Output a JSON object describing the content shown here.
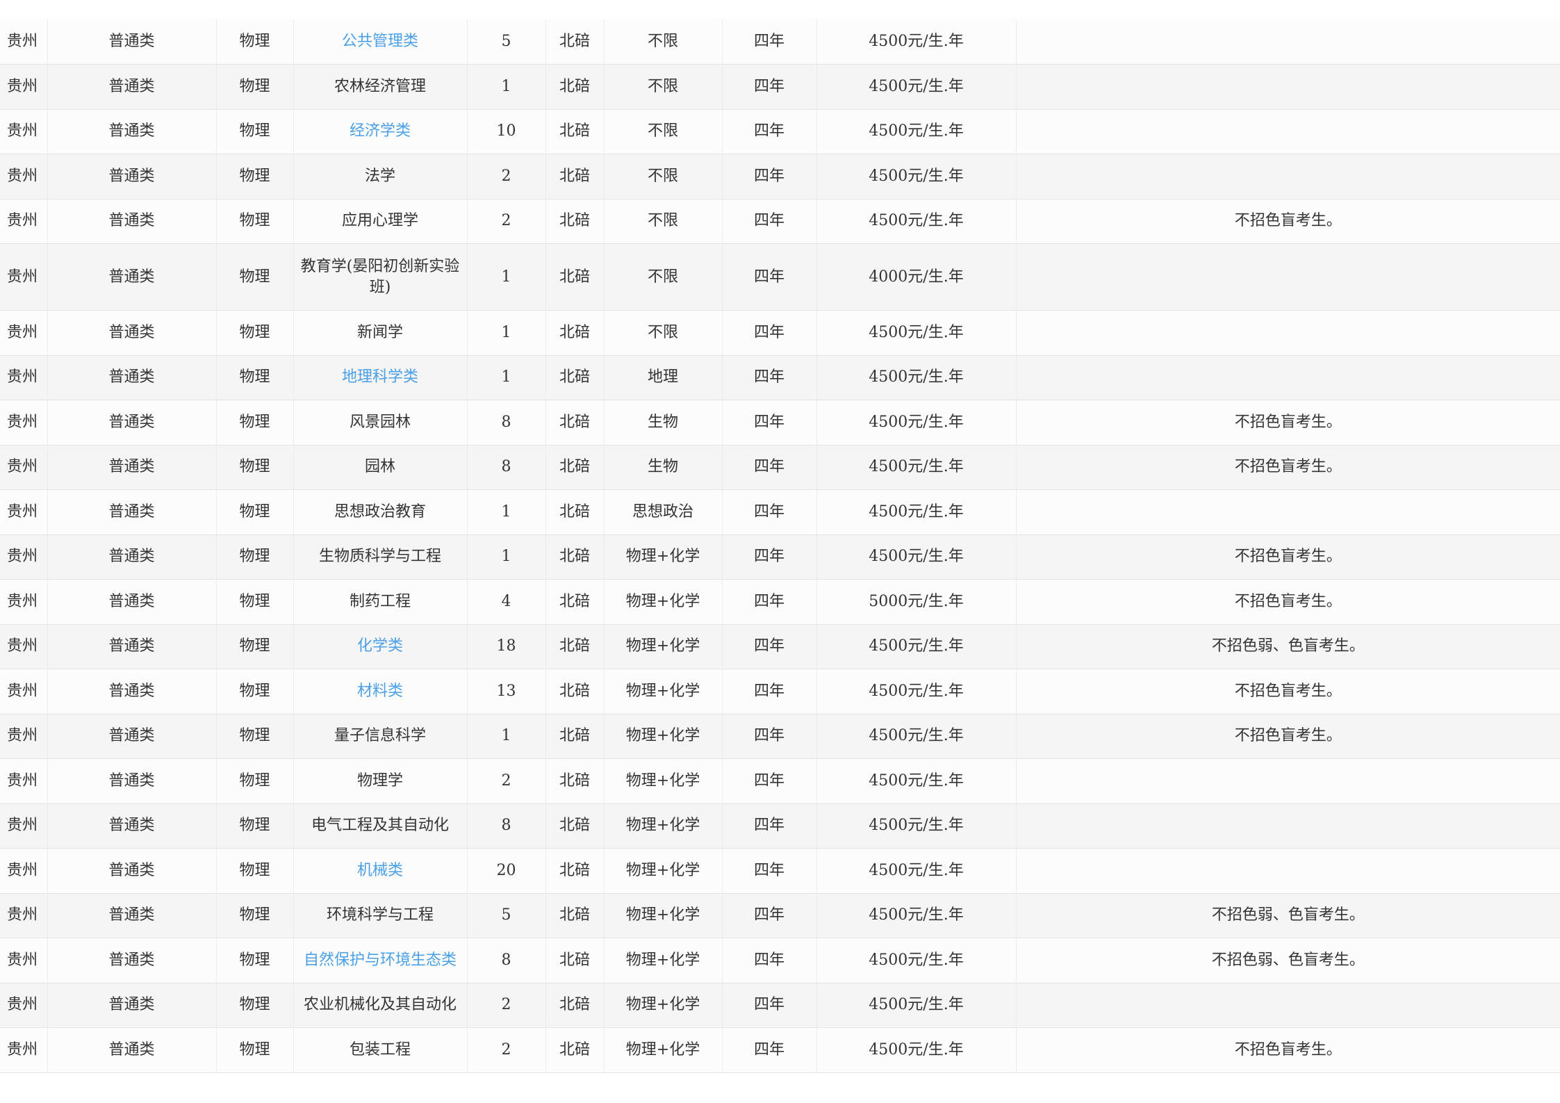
{
  "rows": [
    {
      "province": "贵州",
      "type": "普通类",
      "subject": "物理",
      "major": "公共管理类",
      "is_link": true,
      "count": "5",
      "campus": "北碚",
      "requirement": "不限",
      "duration": "四年",
      "fee": "4500元/生.年",
      "note": ""
    },
    {
      "province": "贵州",
      "type": "普通类",
      "subject": "物理",
      "major": "农林经济管理",
      "is_link": false,
      "count": "1",
      "campus": "北碚",
      "requirement": "不限",
      "duration": "四年",
      "fee": "4500元/生.年",
      "note": ""
    },
    {
      "province": "贵州",
      "type": "普通类",
      "subject": "物理",
      "major": "经济学类",
      "is_link": true,
      "count": "10",
      "campus": "北碚",
      "requirement": "不限",
      "duration": "四年",
      "fee": "4500元/生.年",
      "note": ""
    },
    {
      "province": "贵州",
      "type": "普通类",
      "subject": "物理",
      "major": "法学",
      "is_link": false,
      "count": "2",
      "campus": "北碚",
      "requirement": "不限",
      "duration": "四年",
      "fee": "4500元/生.年",
      "note": ""
    },
    {
      "province": "贵州",
      "type": "普通类",
      "subject": "物理",
      "major": "应用心理学",
      "is_link": false,
      "count": "2",
      "campus": "北碚",
      "requirement": "不限",
      "duration": "四年",
      "fee": "4500元/生.年",
      "note": "不招色盲考生。"
    },
    {
      "province": "贵州",
      "type": "普通类",
      "subject": "物理",
      "major": "教育学(晏阳初创新实验班)",
      "is_link": false,
      "count": "1",
      "campus": "北碚",
      "requirement": "不限",
      "duration": "四年",
      "fee": "4000元/生.年",
      "note": ""
    },
    {
      "province": "贵州",
      "type": "普通类",
      "subject": "物理",
      "major": "新闻学",
      "is_link": false,
      "count": "1",
      "campus": "北碚",
      "requirement": "不限",
      "duration": "四年",
      "fee": "4500元/生.年",
      "note": ""
    },
    {
      "province": "贵州",
      "type": "普通类",
      "subject": "物理",
      "major": "地理科学类",
      "is_link": true,
      "count": "1",
      "campus": "北碚",
      "requirement": "地理",
      "duration": "四年",
      "fee": "4500元/生.年",
      "note": ""
    },
    {
      "province": "贵州",
      "type": "普通类",
      "subject": "物理",
      "major": "风景园林",
      "is_link": false,
      "count": "8",
      "campus": "北碚",
      "requirement": "生物",
      "duration": "四年",
      "fee": "4500元/生.年",
      "note": "不招色盲考生。"
    },
    {
      "province": "贵州",
      "type": "普通类",
      "subject": "物理",
      "major": "园林",
      "is_link": false,
      "count": "8",
      "campus": "北碚",
      "requirement": "生物",
      "duration": "四年",
      "fee": "4500元/生.年",
      "note": "不招色盲考生。"
    },
    {
      "province": "贵州",
      "type": "普通类",
      "subject": "物理",
      "major": "思想政治教育",
      "is_link": false,
      "count": "1",
      "campus": "北碚",
      "requirement": "思想政治",
      "duration": "四年",
      "fee": "4500元/生.年",
      "note": ""
    },
    {
      "province": "贵州",
      "type": "普通类",
      "subject": "物理",
      "major": "生物质科学与工程",
      "is_link": false,
      "count": "1",
      "campus": "北碚",
      "requirement": "物理+化学",
      "duration": "四年",
      "fee": "4500元/生.年",
      "note": "不招色盲考生。"
    },
    {
      "province": "贵州",
      "type": "普通类",
      "subject": "物理",
      "major": "制药工程",
      "is_link": false,
      "count": "4",
      "campus": "北碚",
      "requirement": "物理+化学",
      "duration": "四年",
      "fee": "5000元/生.年",
      "note": "不招色盲考生。"
    },
    {
      "province": "贵州",
      "type": "普通类",
      "subject": "物理",
      "major": "化学类",
      "is_link": true,
      "count": "18",
      "campus": "北碚",
      "requirement": "物理+化学",
      "duration": "四年",
      "fee": "4500元/生.年",
      "note": "不招色弱、色盲考生。"
    },
    {
      "province": "贵州",
      "type": "普通类",
      "subject": "物理",
      "major": "材料类",
      "is_link": true,
      "count": "13",
      "campus": "北碚",
      "requirement": "物理+化学",
      "duration": "四年",
      "fee": "4500元/生.年",
      "note": "不招色盲考生。"
    },
    {
      "province": "贵州",
      "type": "普通类",
      "subject": "物理",
      "major": "量子信息科学",
      "is_link": false,
      "count": "1",
      "campus": "北碚",
      "requirement": "物理+化学",
      "duration": "四年",
      "fee": "4500元/生.年",
      "note": "不招色盲考生。"
    },
    {
      "province": "贵州",
      "type": "普通类",
      "subject": "物理",
      "major": "物理学",
      "is_link": false,
      "count": "2",
      "campus": "北碚",
      "requirement": "物理+化学",
      "duration": "四年",
      "fee": "4500元/生.年",
      "note": ""
    },
    {
      "province": "贵州",
      "type": "普通类",
      "subject": "物理",
      "major": "电气工程及其自动化",
      "is_link": false,
      "count": "8",
      "campus": "北碚",
      "requirement": "物理+化学",
      "duration": "四年",
      "fee": "4500元/生.年",
      "note": ""
    },
    {
      "province": "贵州",
      "type": "普通类",
      "subject": "物理",
      "major": "机械类",
      "is_link": true,
      "count": "20",
      "campus": "北碚",
      "requirement": "物理+化学",
      "duration": "四年",
      "fee": "4500元/生.年",
      "note": ""
    },
    {
      "province": "贵州",
      "type": "普通类",
      "subject": "物理",
      "major": "环境科学与工程",
      "is_link": false,
      "count": "5",
      "campus": "北碚",
      "requirement": "物理+化学",
      "duration": "四年",
      "fee": "4500元/生.年",
      "note": "不招色弱、色盲考生。"
    },
    {
      "province": "贵州",
      "type": "普通类",
      "subject": "物理",
      "major": "自然保护与环境生态类",
      "is_link": true,
      "count": "8",
      "campus": "北碚",
      "requirement": "物理+化学",
      "duration": "四年",
      "fee": "4500元/生.年",
      "note": "不招色弱、色盲考生。"
    },
    {
      "province": "贵州",
      "type": "普通类",
      "subject": "物理",
      "major": "农业机械化及其自动化",
      "is_link": false,
      "count": "2",
      "campus": "北碚",
      "requirement": "物理+化学",
      "duration": "四年",
      "fee": "4500元/生.年",
      "note": ""
    },
    {
      "province": "贵州",
      "type": "普通类",
      "subject": "物理",
      "major": "包装工程",
      "is_link": false,
      "count": "2",
      "campus": "北碚",
      "requirement": "物理+化学",
      "duration": "四年",
      "fee": "4500元/生.年",
      "note": "不招色盲考生。"
    }
  ],
  "colors": {
    "link": "#4a9fe6",
    "text": "#333333"
  }
}
